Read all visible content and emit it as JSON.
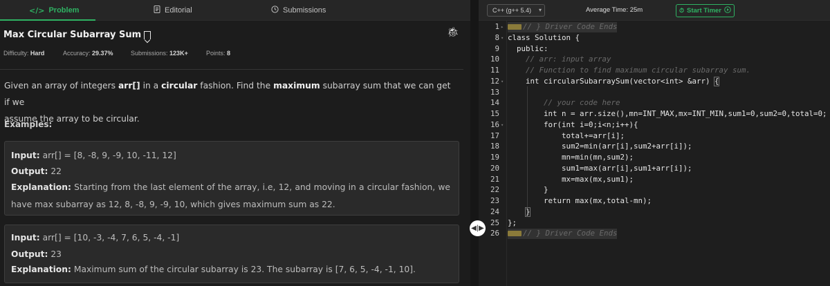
{
  "tabs": {
    "problem": "Problem",
    "editorial": "Editorial",
    "submissions": "Submissions",
    "problem_icon": "</>",
    "editorial_icon": "document-icon",
    "submissions_icon": "clock-icon"
  },
  "problem": {
    "title": "Max Circular Subarray Sum",
    "difficulty_label": "Difficulty:",
    "difficulty": "Hard",
    "accuracy_label": "Accuracy:",
    "accuracy": "29.37%",
    "submissions_label": "Submissions:",
    "submissions": "123K+",
    "points_label": "Points:",
    "points": "8",
    "desc_1": "Given an array of integers ",
    "desc_arr": "arr[]",
    "desc_2": " in a ",
    "desc_circular": "circular",
    "desc_3": " fashion. Find the ",
    "desc_maximum": "maximum",
    "desc_4": " subarray sum that we can get if we",
    "desc_5": "assume the array to be circular.",
    "examples_heading": "Examples:"
  },
  "examples": [
    {
      "input_label": "Input:",
      "input": " arr[] = [8, -8, 9, -9, 10, -11, 12]",
      "output_label": "Output:",
      "output": " 22",
      "explanation_label": "Explanation:",
      "explanation": " Starting from the last element of the array, i.e, 12, and moving in a circular fashion, we have max subarray as 12, 8, -8, 9, -9, 10, which gives maximum sum as 22."
    },
    {
      "input_label": "Input:",
      "input": " arr[] = [10, -3, -4, 7, 6, 5, -4, -1]",
      "output_label": "Output:",
      "output": " 23",
      "explanation_label": "Explanation:",
      "explanation": " Maximum sum of the circular subarray is 23. The subarray is [7, 6, 5, -4, -1, 10]."
    }
  ],
  "toolbar": {
    "language": "C++ (g++ 5.4)",
    "avg_time": "Average Time: 25m",
    "timer_label": "Start Timer"
  },
  "editor": {
    "line_numbers": [
      "1",
      "8",
      "9",
      "10",
      "11",
      "12",
      "13",
      "14",
      "15",
      "16",
      "17",
      "18",
      "19",
      "20",
      "21",
      "22",
      "23",
      "24",
      "25",
      "26"
    ],
    "lines": [
      "// } Driver Code Ends",
      "class Solution {",
      "  public:",
      "    // arr: input array",
      "    // Function to find maximum circular subarray sum.",
      "    int circularSubarraySum(vector<int> &arr) {",
      "",
      "        // your code here",
      "        int n = arr.size(),mn=INT_MAX,mx=INT_MIN,sum1=0,sum2=0,total=0;",
      "        for(int i=0;i<n;i++){",
      "            total+=arr[i];",
      "            sum2=min(arr[i],sum2+arr[i]);",
      "            mn=min(mn,sum2);",
      "            sum1=max(arr[i],sum1+arr[i]);",
      "            mx=max(mx,sum1);",
      "        }",
      "        return max(mx,total-mn);",
      "    }",
      "};",
      "// } Driver Code Ends"
    ]
  },
  "colors": {
    "accent": "#2fb363",
    "background": "#1c1c1c",
    "editor_bg": "#1e1e1e"
  }
}
